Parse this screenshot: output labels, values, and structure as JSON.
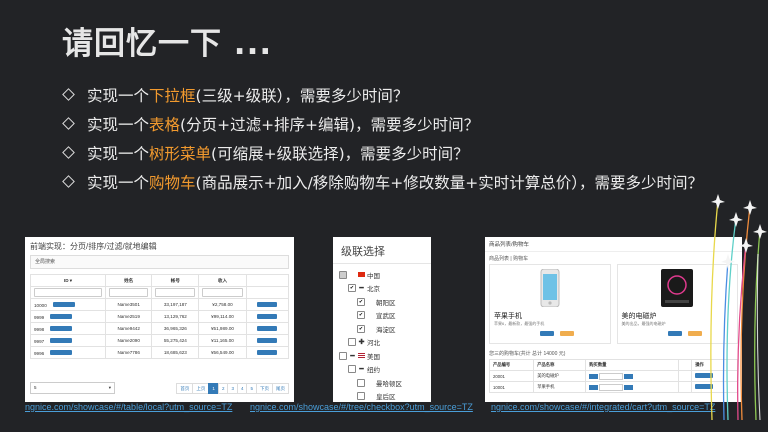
{
  "slide": {
    "title": "请回忆一下 ..."
  },
  "bullets": [
    {
      "pre": "实现一个",
      "hl": "下拉框",
      "post": "(三级+级联），需要多少时间？"
    },
    {
      "pre": "实现一个",
      "hl": "表格",
      "post": "(分页+过滤+排序+编辑)，需要多少时间？"
    },
    {
      "pre": "实现一个",
      "hl": "树形菜单",
      "post": "(可缩展+级联选择)，需要多少时间？"
    },
    {
      "pre": "实现一个",
      "hl": "购物车",
      "post": "(商品展示+加入/移除购物车+修改数量+实时计算总价），需要多少时间？"
    }
  ],
  "colors": {
    "background": "#222326",
    "highlight": "#f29a2e",
    "link": "#4a9ed8",
    "primary_button": "#337ab7"
  },
  "table_demo": {
    "title": "前端实现：分页/排序/过滤/就地编辑",
    "search_label": "全局搜索",
    "columns": [
      "ID ▾",
      "姓名",
      "帐号",
      "收入",
      ""
    ],
    "rows": [
      {
        "id": "10000",
        "name": "Name3501",
        "account": "33,197,187",
        "income": "¥2,758.00"
      },
      {
        "id": "9999",
        "name": "Name2519",
        "account": "13,129,762",
        "income": "¥99,114.00"
      },
      {
        "id": "9998",
        "name": "Name9442",
        "account": "36,965,326",
        "income": "¥51,989.00"
      },
      {
        "id": "9997",
        "name": "Name2090",
        "account": "55,275,424",
        "income": "¥11,165.00"
      },
      {
        "id": "9996",
        "name": "Name7786",
        "account": "18,685,623",
        "income": "¥56,549.00"
      }
    ],
    "page_size": "5",
    "pager": [
      "首页",
      "上页",
      "1",
      "2",
      "3",
      "4",
      "5",
      "下页",
      "尾页"
    ],
    "pager_active": "1"
  },
  "tree_demo": {
    "title": "级联选择",
    "nodes": [
      {
        "label": "中国",
        "toggle": "▾",
        "check": "part",
        "flag": "cn",
        "indent": 0
      },
      {
        "label": "北京",
        "toggle": "━",
        "check": "on",
        "flag": "",
        "indent": 1
      },
      {
        "label": "朝阳区",
        "toggle": "",
        "check": "on",
        "flag": "",
        "indent": 2
      },
      {
        "label": "宣武区",
        "toggle": "",
        "check": "on",
        "flag": "",
        "indent": 2
      },
      {
        "label": "海淀区",
        "toggle": "",
        "check": "on",
        "flag": "",
        "indent": 2
      },
      {
        "label": "河北",
        "toggle": "✚",
        "check": "off",
        "flag": "",
        "indent": 1
      },
      {
        "label": "美国",
        "toggle": "━",
        "check": "off",
        "flag": "us",
        "indent": 0
      },
      {
        "label": "纽约",
        "toggle": "━",
        "check": "off",
        "flag": "",
        "indent": 1
      },
      {
        "label": "曼哈顿区",
        "toggle": "",
        "check": "off",
        "flag": "",
        "indent": 2
      },
      {
        "label": "皇后区",
        "toggle": "",
        "check": "off",
        "flag": "",
        "indent": 2
      }
    ]
  },
  "cart_demo": {
    "title": "商品列表/购物车",
    "products_heading": "商品列表 | 购物车",
    "products": [
      {
        "name": "苹果手机",
        "desc": "苹果6，最新款，最强的手机"
      },
      {
        "name": "美的电磁炉",
        "desc": "美的出品，最强的电磁炉"
      }
    ],
    "cart_heading": "您三的购物车(共计 总计 14000 元)",
    "columns": [
      "产品编号",
      "产品名称",
      "购买数量",
      "",
      "操作"
    ],
    "rows": [
      {
        "id": "20001",
        "name": "美的电磁炉"
      },
      {
        "id": "10001",
        "name": "苹果手机"
      }
    ]
  },
  "links": [
    "ngnice.com/showcase/#/table/local?utm_source=TZ",
    "ngnice.com/showcase/#/tree/checkbox?utm_source=TZ",
    "ngnice.com/showcase/#/integrated/cart?utm_source=TZ"
  ]
}
